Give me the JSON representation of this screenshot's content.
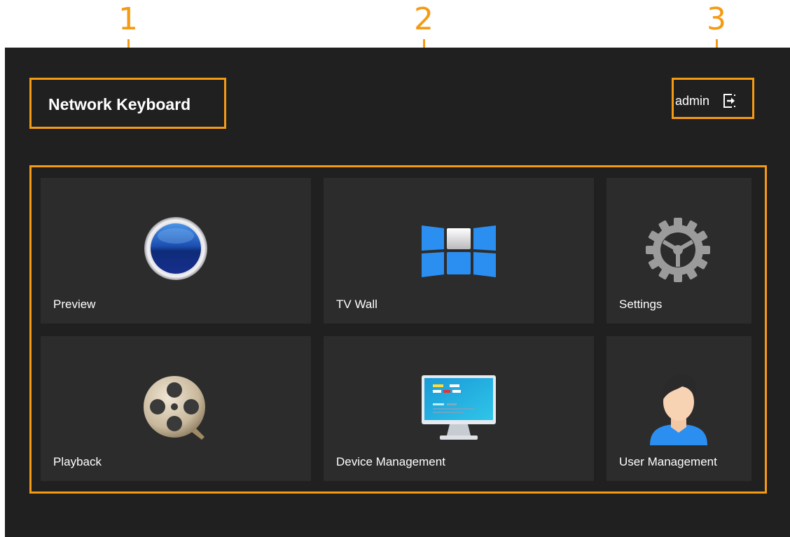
{
  "callouts": {
    "c1": "1",
    "c2": "2",
    "c3": "3"
  },
  "header": {
    "title": "Network Keyboard",
    "user": "admin",
    "logout_icon": "logout-icon"
  },
  "tiles": [
    {
      "label": "Preview",
      "icon": "preview-lens-icon"
    },
    {
      "label": "TV Wall",
      "icon": "tv-wall-icon"
    },
    {
      "label": "Settings",
      "icon": "gear-icon"
    },
    {
      "label": "Playback",
      "icon": "film-reel-icon"
    },
    {
      "label": "Device Management",
      "icon": "monitor-icon"
    },
    {
      "label": "User Management",
      "icon": "user-avatar-icon"
    }
  ],
  "colors": {
    "highlight": "#f59a13",
    "background": "#202020",
    "tile": "#2c2c2c",
    "text": "#ffffff"
  }
}
